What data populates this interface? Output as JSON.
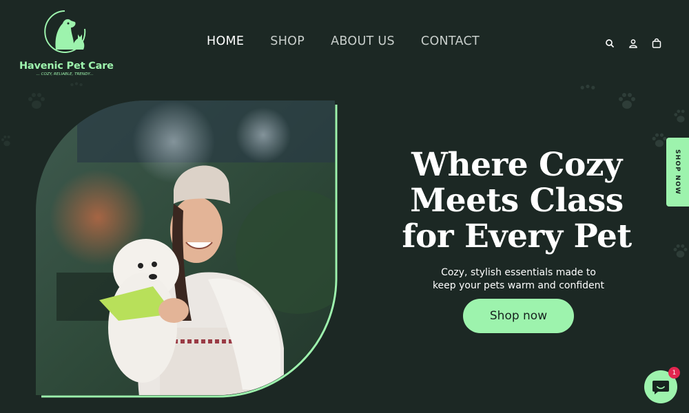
{
  "brand": {
    "name": "Havenic Pet Care",
    "tagline": "... COZY, RELIABLE, TRENDY...",
    "logo_icon": "dog-cat-logo-icon",
    "accent_color": "#9df3ad",
    "background_color": "#1c2824"
  },
  "nav": {
    "items": [
      {
        "label": "HOME",
        "active": true
      },
      {
        "label": "SHOP",
        "active": false
      },
      {
        "label": "ABOUT US",
        "active": false
      },
      {
        "label": "CONTACT",
        "active": false
      }
    ]
  },
  "header_icons": [
    "search-icon",
    "account-icon",
    "cart-icon"
  ],
  "hero": {
    "headline_lines": [
      "Where Cozy",
      "Meets Class",
      "for Every Pet"
    ],
    "subtitle_lines": [
      "Cozy, stylish essentials made to",
      "keep your pets warm and confident"
    ],
    "cta_label": "Shop now",
    "image_description_icon": "woman-holding-dog-photo"
  },
  "side_tab": {
    "label": "SHOP NOW"
  },
  "chat": {
    "icon": "chat-bubble-icon",
    "badge_count": "1"
  }
}
